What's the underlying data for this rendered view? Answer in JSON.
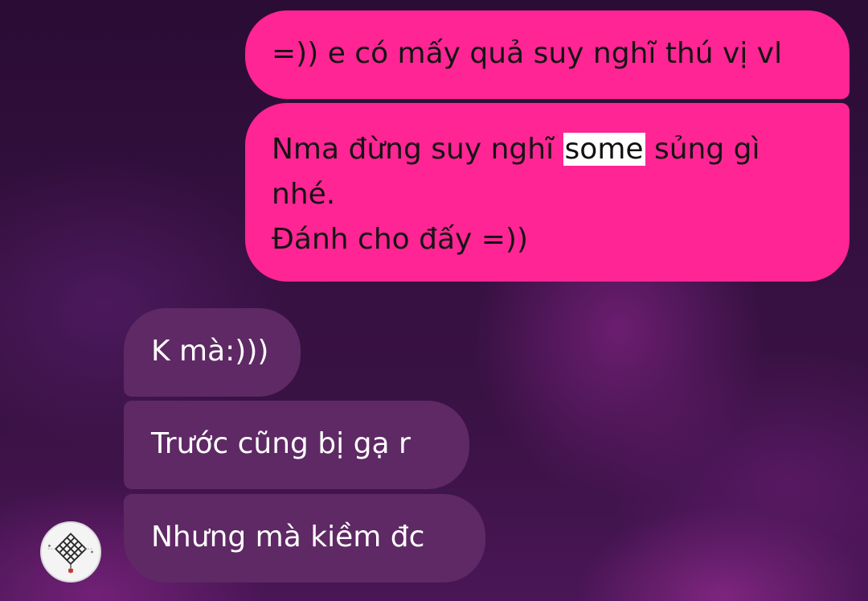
{
  "messages": {
    "outgoing_1": "=)) e có mấy quả suy nghĩ thú vị vl",
    "outgoing_2": {
      "line1_before": "Nma đừng suy nghĩ ",
      "line1_highlight": "some",
      "line1_after": " sủng gì",
      "line2": "nhé.",
      "line3": "Đánh cho đấy =))"
    },
    "incoming_1": "K mà:)))",
    "incoming_2": "Trước cũng bị gạ r",
    "incoming_3": "Nhưng mà kiềm đc"
  },
  "avatar": {
    "icon": "endless-knot-avatar-icon"
  },
  "colors": {
    "outgoing_bubble": "#ff2594",
    "incoming_bubble": "#5e2964",
    "background": "#34103f",
    "highlight": "#ffffff"
  }
}
